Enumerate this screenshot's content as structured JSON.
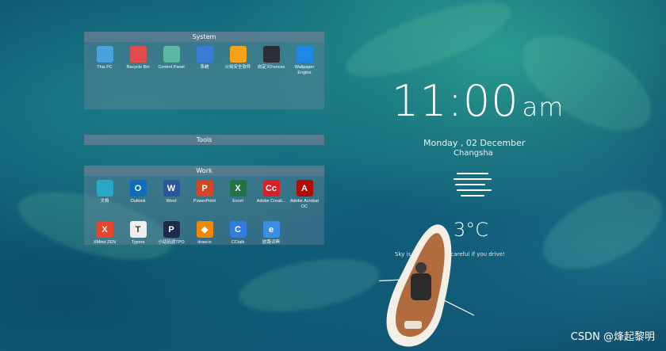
{
  "fences": [
    {
      "title": "System",
      "items": [
        {
          "label": "This PC",
          "icon": "monitor-icon",
          "color": "#4aa3df"
        },
        {
          "label": "Recycle Bin",
          "icon": "recycle-bin-icon",
          "color": "#e04b4b"
        },
        {
          "label": "Control Panel",
          "icon": "control-panel-icon",
          "color": "#5bb8a5"
        },
        {
          "label": "系统",
          "icon": "finder-icon",
          "color": "#3a7bd5"
        },
        {
          "label": "火绒安全软件",
          "icon": "shield-icon",
          "color": "#f2a31b"
        },
        {
          "label": "自定义Fences",
          "icon": "fences-icon",
          "color": "#2b2f36"
        },
        {
          "label": "Wallpaper Engine",
          "icon": "gear-icon",
          "color": "#1e88e5"
        }
      ]
    },
    {
      "title": "Tools",
      "items": []
    },
    {
      "title": "Work",
      "items": [
        {
          "label": "文档",
          "icon": "folder-icon",
          "color": "#2aa6c9"
        },
        {
          "label": "Outlook",
          "icon": "outlook-icon",
          "color": "#0f6cbd",
          "glyph": "O"
        },
        {
          "label": "Word",
          "icon": "word-icon",
          "color": "#2b579a",
          "glyph": "W"
        },
        {
          "label": "PowerPoint",
          "icon": "powerpoint-icon",
          "color": "#d24726",
          "glyph": "P"
        },
        {
          "label": "Excel",
          "icon": "excel-icon",
          "color": "#217346",
          "glyph": "X"
        },
        {
          "label": "Adobe Creati...",
          "icon": "creative-cloud-icon",
          "color": "#da1f26",
          "glyph": "Cc"
        },
        {
          "label": "Adobe Acrobat DC",
          "icon": "acrobat-icon",
          "color": "#b30b00",
          "glyph": "A"
        },
        {
          "label": "XMind ZEN",
          "icon": "xmind-icon",
          "color": "#e8452c",
          "glyph": "X"
        },
        {
          "label": "Typora",
          "icon": "typora-icon",
          "color": "#eeeeee",
          "glyph": "T"
        },
        {
          "label": "小站码渡TPO",
          "icon": "tpo-icon",
          "color": "#1f2b4a",
          "glyph": "P"
        },
        {
          "label": "draw.io",
          "icon": "drawio-icon",
          "color": "#f08705",
          "glyph": "◆"
        },
        {
          "label": "CCtalk",
          "icon": "cctalk-icon",
          "color": "#2f7de1",
          "glyph": "C"
        },
        {
          "label": "欧路词典",
          "icon": "eudic-icon",
          "color": "#3a8ee6",
          "glyph": "e"
        }
      ]
    }
  ],
  "clock": {
    "time": "11:00",
    "ampm": "am"
  },
  "date": "Monday , 02 December",
  "city": "Changsha",
  "weather": {
    "temp": "3°C",
    "condition": "Sky is obscured. Be careful if you drive!",
    "icon": "fog-icon"
  },
  "watermark": "CSDN @烽起黎明"
}
